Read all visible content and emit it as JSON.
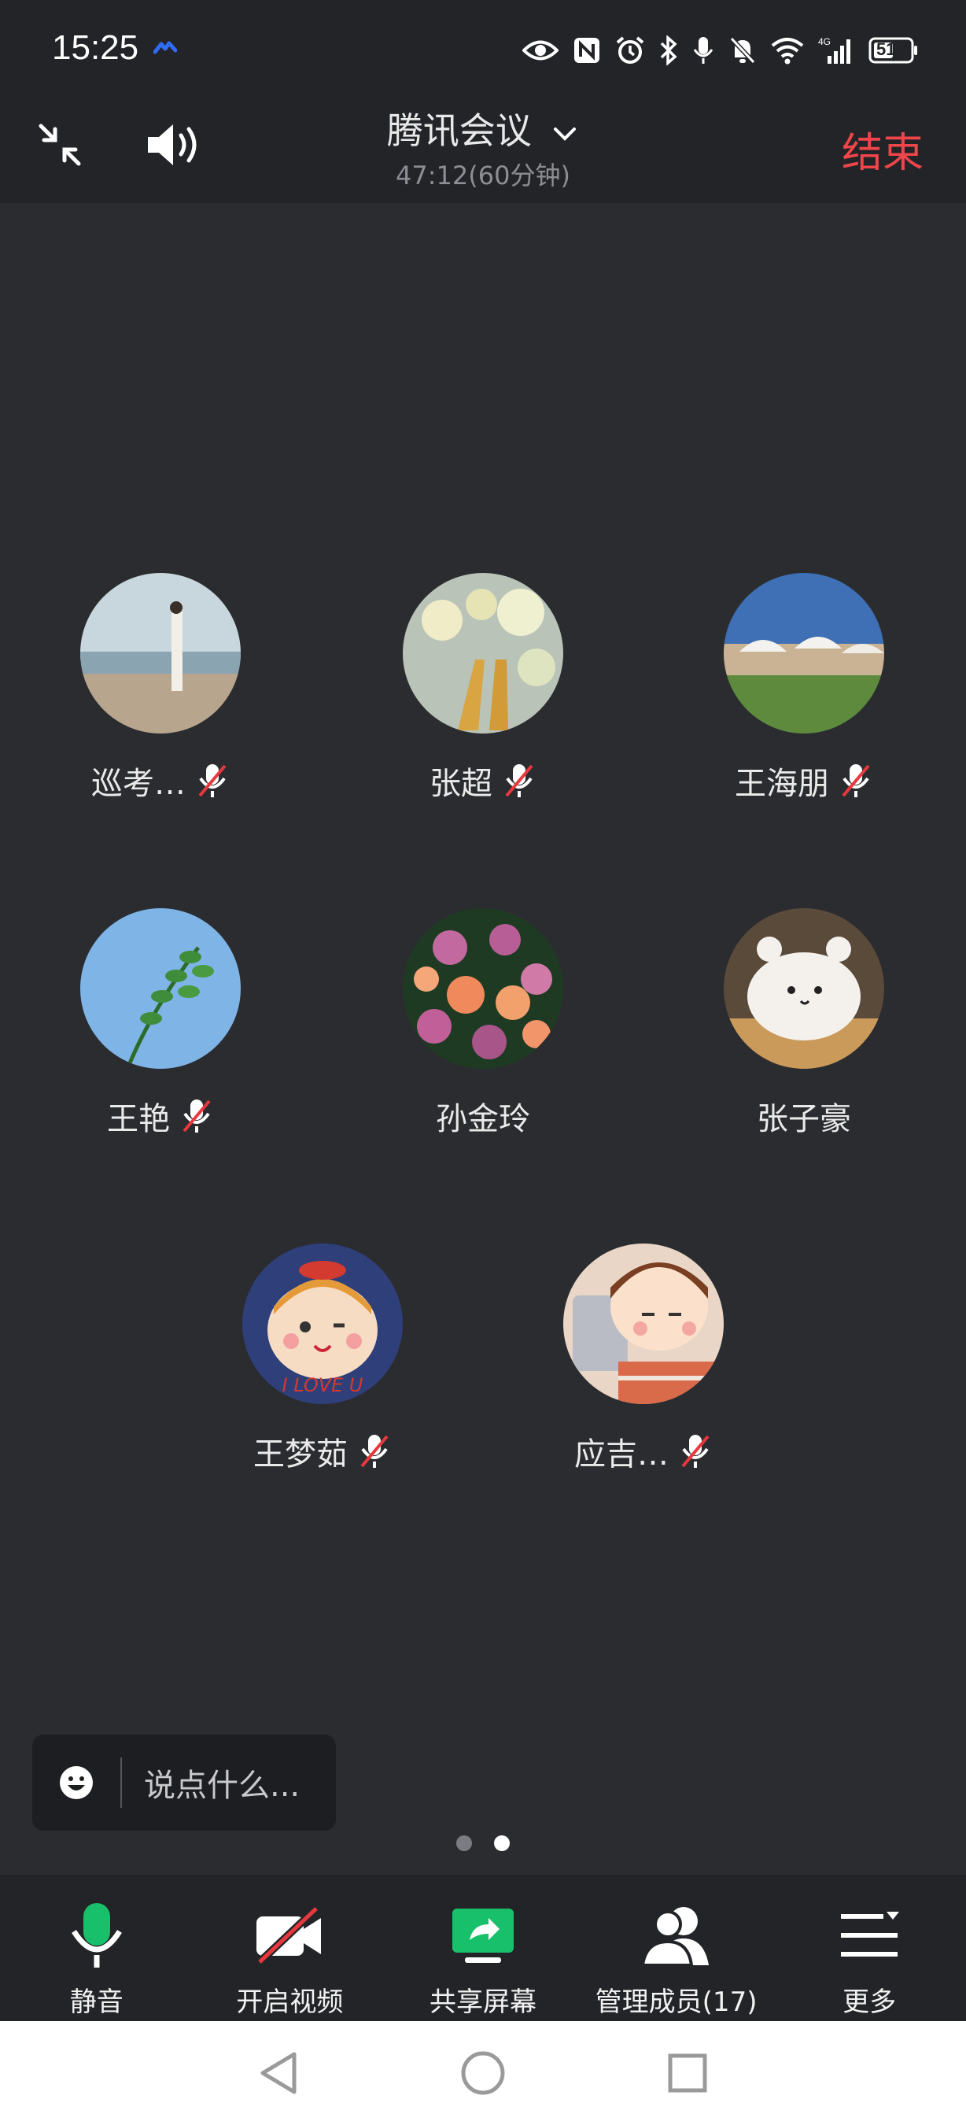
{
  "status_bar": {
    "time": "15:25",
    "battery": "51",
    "icons": [
      "app-notification-icon",
      "eye-icon",
      "nfc-icon",
      "alarm-icon",
      "bluetooth-icon",
      "microphone-icon",
      "bell-off-icon",
      "wifi-icon",
      "signal-4g-icon",
      "battery-icon"
    ]
  },
  "header": {
    "title": "腾讯会议",
    "duration": "47:12(60分钟)",
    "end_label": "结束",
    "end_color": "#f0454a",
    "left_icons": [
      "collapse-icon",
      "speaker-icon"
    ]
  },
  "participants": [
    {
      "name": "巡考…",
      "muted": true,
      "avatar": "beach-photo"
    },
    {
      "name": "张超",
      "muted": true,
      "avatar": "blossom-hands-photo"
    },
    {
      "name": "王海朋",
      "muted": true,
      "avatar": "resort-photo"
    },
    {
      "name": "王艳",
      "muted": true,
      "avatar": "leaf-sky-photo"
    },
    {
      "name": "孙金玲",
      "muted": false,
      "avatar": "flower-bouquet-photo"
    },
    {
      "name": "张子豪",
      "muted": false,
      "avatar": "bear-dessert-photo"
    },
    {
      "name": "王梦茹",
      "muted": true,
      "avatar": "cartoon-girl",
      "avatar_text": "I LOVE U"
    },
    {
      "name": "应吉…",
      "muted": true,
      "avatar": "cartoon-boy-laptop"
    }
  ],
  "chat": {
    "placeholder": "说点什么..."
  },
  "pager": {
    "pages": 2,
    "active": 2
  },
  "toolbar": {
    "mute": "静音",
    "video": "开启视频",
    "share": "共享屏幕",
    "members": "管理成员(17)",
    "more": "更多",
    "accent": "#19c06b"
  },
  "navbar": [
    "back-icon",
    "home-icon",
    "recents-icon"
  ]
}
